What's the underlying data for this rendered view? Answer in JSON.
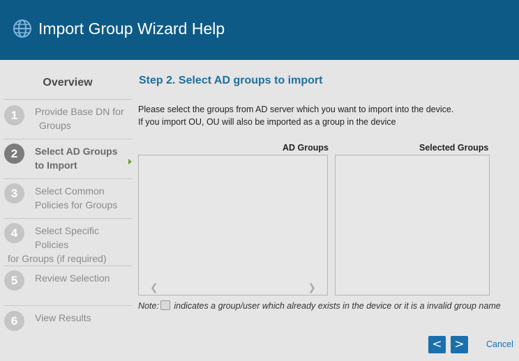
{
  "window": {
    "title": "Import Group Wizard Help",
    "icon": "globe-icon",
    "header_color": "#0e5a86"
  },
  "sidebar": {
    "overview_label": "Overview",
    "steps": [
      {
        "number": "1",
        "line1": "Provide Base DN for",
        "line2": "Groups",
        "active": false
      },
      {
        "number": "2",
        "line1": "Select AD Groups",
        "line2": "to  Import",
        "active": true
      },
      {
        "number": "3",
        "line1": "Select Common",
        "line2": "Policies  for Groups",
        "active": false
      },
      {
        "number": "4",
        "line1": "Select Specific",
        "line2": "Policies",
        "line3": "for Groups (if required)",
        "active": false
      },
      {
        "number": "5",
        "line1": "Review Selection",
        "active": false
      },
      {
        "number": "6",
        "line1": "View Results",
        "active": false
      }
    ]
  },
  "main": {
    "step_title": "Step 2. Select AD groups to import",
    "description_line1": "Please select the groups from AD server which you want to import into the device.",
    "description_line2": "If you import OU, OU will also be imported as a group in the device",
    "ad_groups_label": "AD Groups",
    "selected_groups_label": "Selected Groups",
    "note_prefix": "Note:",
    "note_text": "indicates a group/user which already exists in the device or it is a invalid group name",
    "prev_button": "<",
    "next_button": ">",
    "cancel_label": "Cancel"
  },
  "colors": {
    "accent": "#1a6fad",
    "step_title": "#1f6e9e",
    "active_step_arrow": "#6aa12a"
  }
}
